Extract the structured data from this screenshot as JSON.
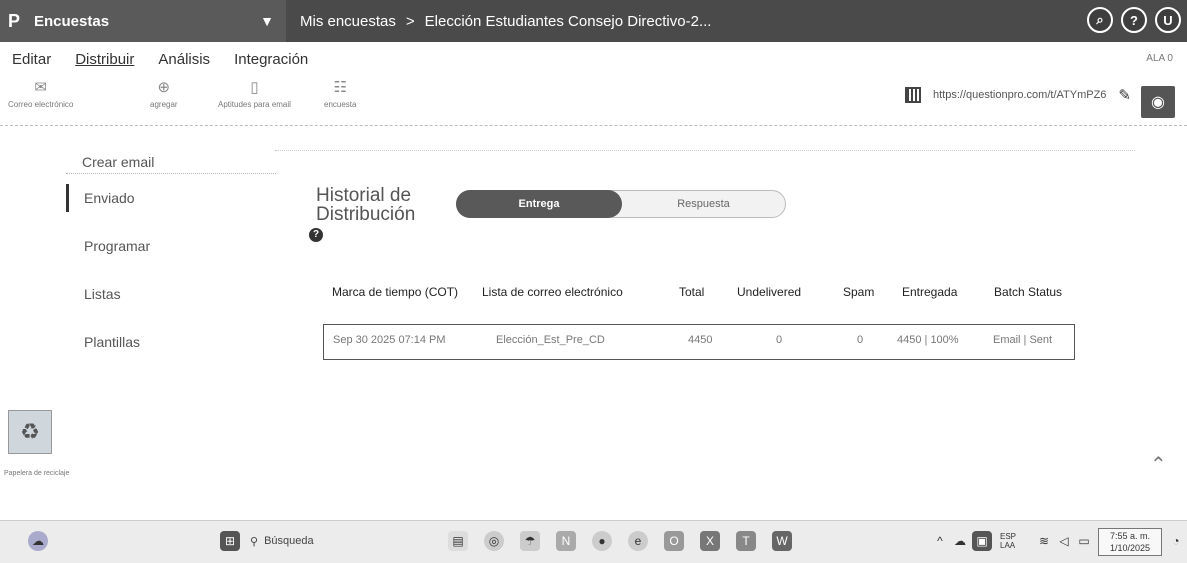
{
  "header": {
    "brand": "Encuestas",
    "breadcrumb": [
      "Mis encuestas",
      "Elección Estudiantes Consejo Directivo-2..."
    ],
    "breadcrumb_sep": ">",
    "icons": [
      "search-icon",
      "help-icon",
      "user-icon"
    ],
    "user_initial": "U"
  },
  "menu": {
    "items": [
      "Editar",
      "Distribuir",
      "Análisis",
      "Integración"
    ],
    "active": "Distribuir",
    "right_text": "ALA 0"
  },
  "toolbar": {
    "tools": [
      "Correo electrónico",
      "agregar",
      "Aptitudes para email",
      "encuesta"
    ],
    "url": "https://questionpro.com/t/ATYmPZ6"
  },
  "sidebar": {
    "items": [
      "Crear email",
      "Enviado",
      "Programar",
      "Listas",
      "Plantillas"
    ],
    "active": "Enviado"
  },
  "main": {
    "title": "Historial de Distribución",
    "toggle": {
      "on": "Entrega",
      "off": "Respuesta"
    },
    "columns": [
      "Marca de tiempo (COT)",
      "Lista de correo electrónico",
      "Total",
      "Undelivered",
      "Spam",
      "Entregada",
      "Batch Status"
    ],
    "rows": [
      [
        "Sep 30 2025 07:14 PM",
        "Elección_Est_Pre_CD",
        "4450",
        "0",
        "0",
        "4450 | 100%",
        "Email | Sent"
      ]
    ]
  },
  "desktop": {
    "recycle_label": "Papelera de reciclaje"
  },
  "taskbar": {
    "search_placeholder": "Búsqueda",
    "lang": "ESP",
    "lang_sub": "LAA",
    "time": "7:55 a. m.",
    "date": "1/10/2025"
  }
}
